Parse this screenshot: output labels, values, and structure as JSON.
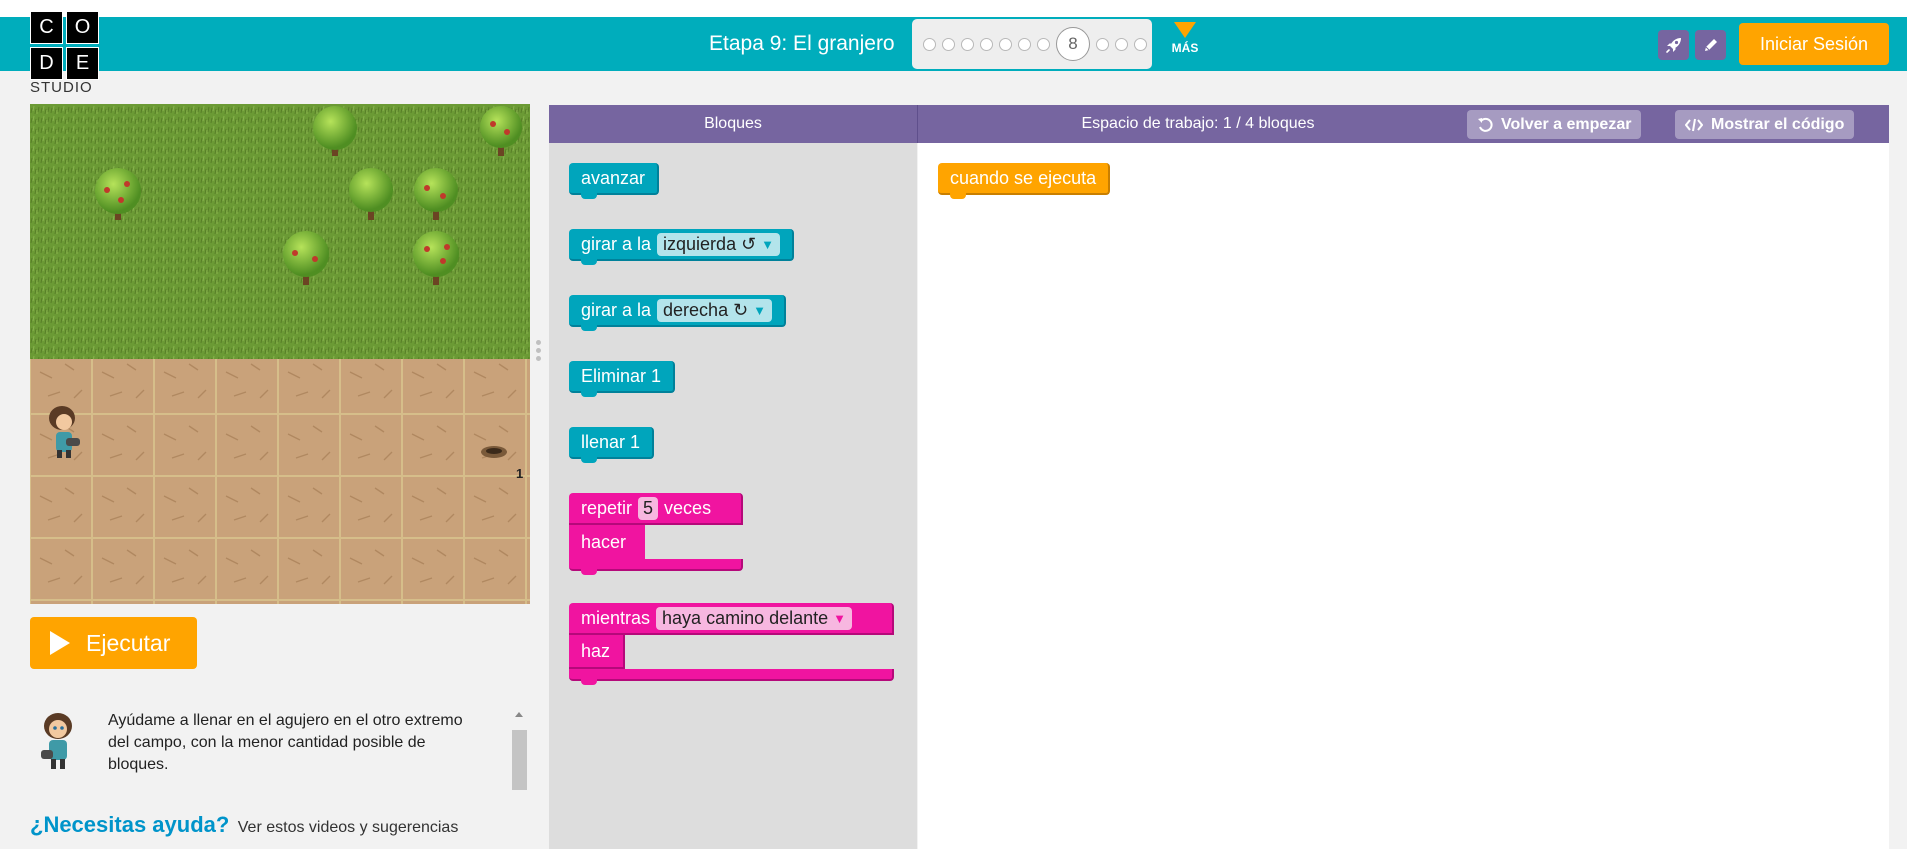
{
  "header": {
    "logo_letters": [
      "C",
      "O",
      "D",
      "E"
    ],
    "logo_subtitle": "STUDIO",
    "stage_title": "Etapa 9: El granjero",
    "progress": {
      "total_levels": 11,
      "current_level": 8,
      "current_label": "8"
    },
    "more_label": "MÁS",
    "icon_buttons": [
      {
        "name": "rocket-icon"
      },
      {
        "name": "pencil-icon"
      }
    ],
    "signin_label": "Iniciar Sesión",
    "colors": {
      "bar": "#00adbc",
      "accent": "#ffa400",
      "icon_button": "#7665a0"
    }
  },
  "game": {
    "goal_value": "1",
    "run_label": "Ejecutar"
  },
  "instructions": {
    "text": "Ayúdame a llenar en el agujero en el otro extremo del campo, con la menor cantidad posible de bloques."
  },
  "help": {
    "title": "¿Necesitas ayuda?",
    "text": "Ver estos videos y sugerencias"
  },
  "workspace": {
    "toolbox_title": "Bloques",
    "space_title": "Espacio de trabajo: 1 / 4 bloques",
    "restart_label": "Volver a empezar",
    "show_code_label": "Mostrar el código",
    "colors": {
      "header": "#7665a0",
      "button": "#a69bc1"
    }
  },
  "toolbox": {
    "move_forward": "avanzar",
    "turn_left_prefix": "girar a la",
    "turn_left_option": "izquierda ↺",
    "turn_right_prefix": "girar a la",
    "turn_right_option": "derecha ↻",
    "remove": "Eliminar 1",
    "fill": "llenar 1",
    "repeat_prefix": "repetir",
    "repeat_count": "5",
    "repeat_suffix": "veces",
    "repeat_do": "hacer",
    "while_prefix": "mientras",
    "while_condition": "haya camino delante",
    "while_do": "haz",
    "colors": {
      "movement": "#00a5bc",
      "loops": "#f014a0",
      "event": "#ffa400"
    }
  },
  "workspace_blocks": {
    "when_run": "cuando se ejecuta"
  }
}
